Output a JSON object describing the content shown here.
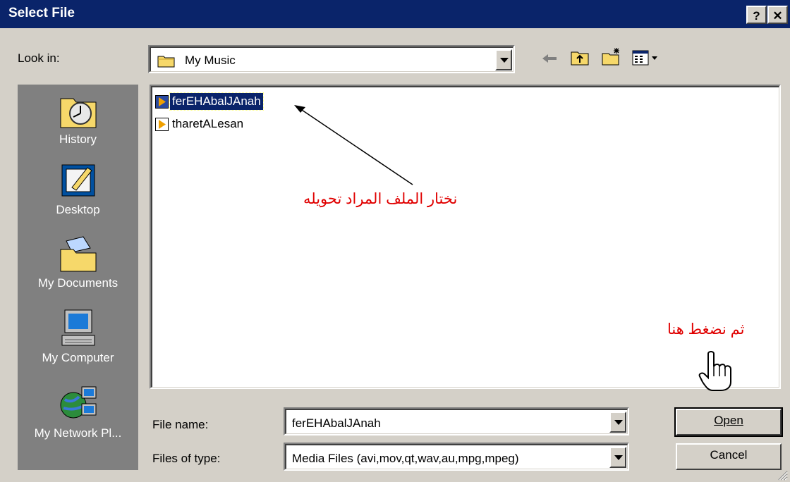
{
  "window": {
    "title": "Select File",
    "help_glyph": "?",
    "close_glyph": "✕"
  },
  "lookin": {
    "label": "Look in:",
    "value": "My Music"
  },
  "toolbar": {
    "icons": [
      "back-icon",
      "up-folder-icon",
      "new-folder-icon",
      "view-menu-icon"
    ]
  },
  "places": [
    {
      "label": "History",
      "icon": "history-icon"
    },
    {
      "label": "Desktop",
      "icon": "desktop-icon"
    },
    {
      "label": "My Documents",
      "icon": "my-documents-icon"
    },
    {
      "label": "My Computer",
      "icon": "my-computer-icon"
    },
    {
      "label": "My Network Pl...",
      "icon": "my-network-places-icon"
    }
  ],
  "files": [
    {
      "name": "ferEHAbalJAnah",
      "selected": true
    },
    {
      "name": "tharetALesan",
      "selected": false
    }
  ],
  "annotations": {
    "select_file_note": "نختار الملف المراد تحويله",
    "click_here_note": "ثم نضغط هنا",
    "color": "#e00000"
  },
  "filename": {
    "label": "File name:",
    "value": "ferEHAbalJAnah"
  },
  "filetype": {
    "label": "Files of type:",
    "value": "Media Files (avi,mov,qt,wav,au,mpg,mpeg)"
  },
  "buttons": {
    "open": "Open",
    "cancel": "Cancel"
  },
  "colors": {
    "titlebar": "#0a246a",
    "dialog_bg": "#d4d0c8",
    "places_bg": "#808080",
    "selection": "#0a246a"
  }
}
